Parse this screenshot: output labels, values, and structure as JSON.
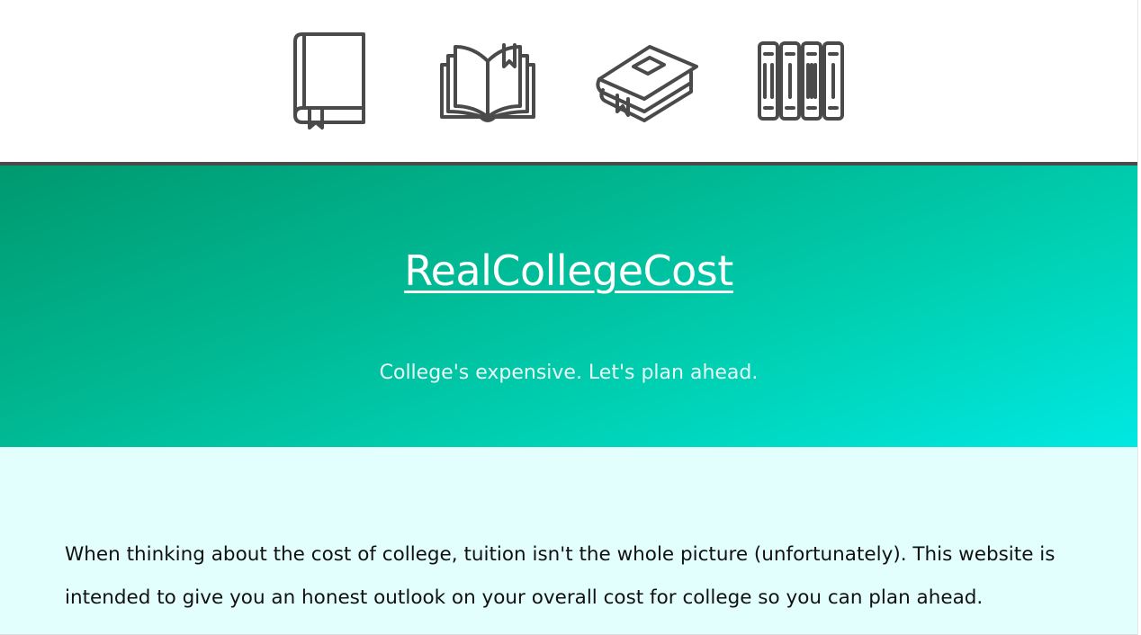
{
  "header": {
    "icons": [
      "closed-book-icon",
      "open-book-icon",
      "lying-book-icon",
      "book-stack-icon"
    ],
    "icon_color": "#4a4a4a"
  },
  "hero": {
    "title": "RealCollegeCost",
    "tagline": "College's expensive. Let's plan ahead.",
    "gradient_colors": [
      "#00996f",
      "#00e8e3"
    ]
  },
  "intro": {
    "text": "When thinking about the cost of college, tuition isn't the whole picture (unfortunately). This website is intended to give you an honest outlook on your overall cost for college so you can plan ahead.",
    "background": "#e2fffd"
  }
}
